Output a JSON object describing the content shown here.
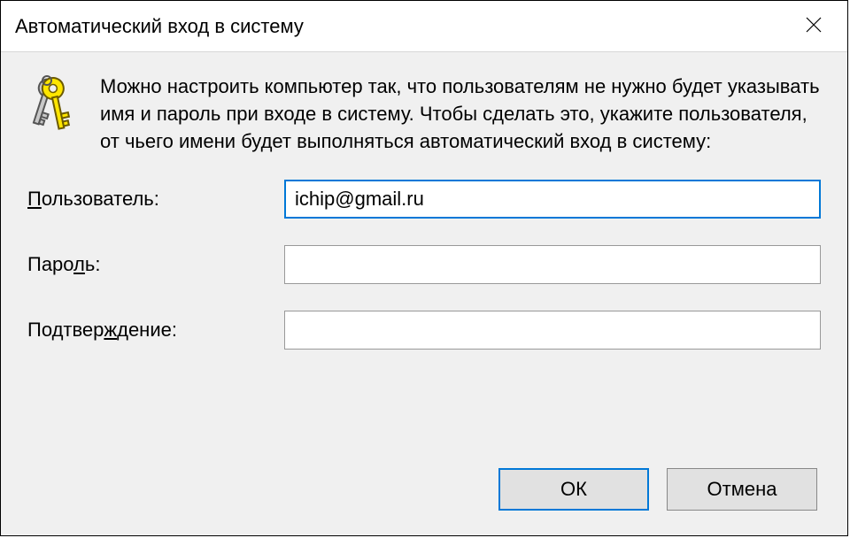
{
  "dialog": {
    "title": "Автоматический вход в систему",
    "description": "Можно настроить компьютер так, что пользователям не нужно будет указывать имя и пароль при входе в систему. Чтобы сделать это, укажите пользователя, от чьего имени будет выполняться автоматический вход в систему:",
    "fields": {
      "user": {
        "label_pre": "",
        "label_u": "П",
        "label_post": "ользователь:",
        "value": "ichip@gmail.ru"
      },
      "password": {
        "label_pre": "Паро",
        "label_u": "л",
        "label_post": "ь:",
        "value": ""
      },
      "confirm": {
        "label_pre": "Подтвер",
        "label_u": "ж",
        "label_post": "дение:",
        "value": ""
      }
    },
    "buttons": {
      "ok": "ОК",
      "cancel": "Отмена"
    }
  }
}
